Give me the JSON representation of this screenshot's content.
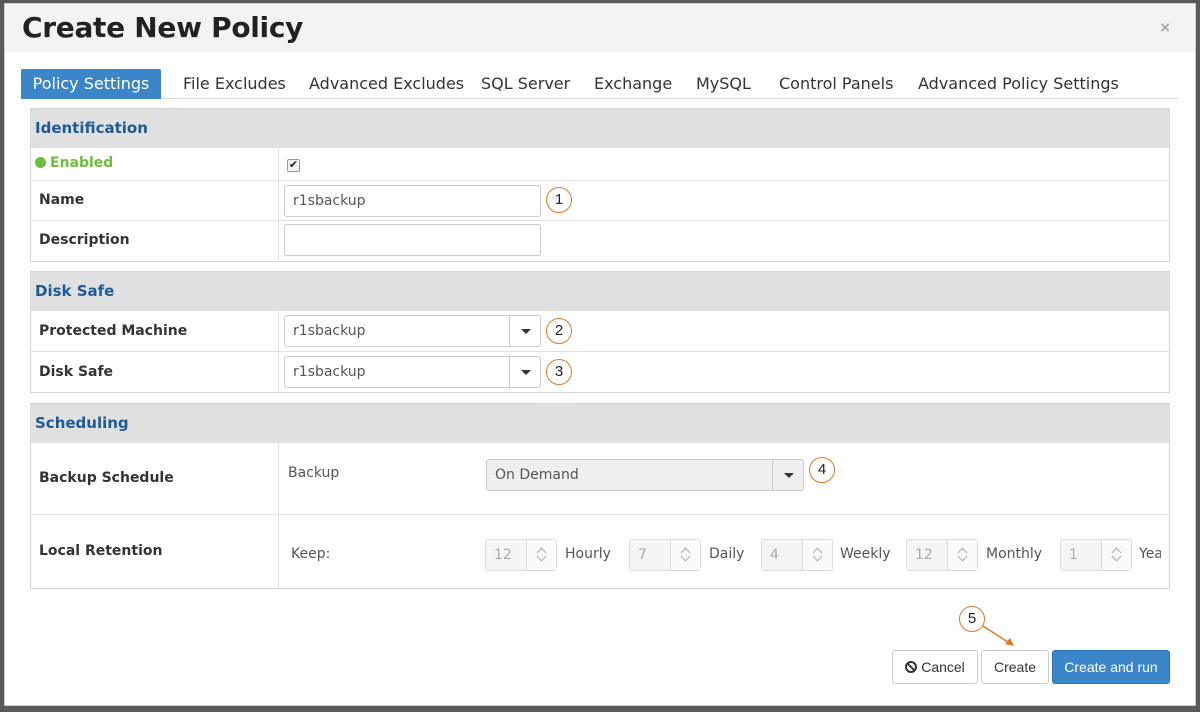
{
  "modal": {
    "title": "Create New Policy",
    "close": "×"
  },
  "tabs": [
    "Policy Settings",
    "File Excludes",
    "Advanced Excludes",
    "SQL Server",
    "Exchange",
    "MySQL",
    "Control Panels",
    "Advanced Policy Settings"
  ],
  "identification": {
    "heading": "Identification",
    "enabled_label": "Enabled",
    "enabled_checked": "✔",
    "name_label": "Name",
    "name_value": "r1sbackup",
    "description_label": "Description",
    "description_value": ""
  },
  "disk_safe": {
    "heading": "Disk Safe",
    "machine_label": "Protected Machine",
    "machine_value": "r1sbackup",
    "safe_label": "Disk Safe",
    "safe_value": "r1sbackup"
  },
  "scheduling": {
    "heading": "Scheduling",
    "schedule_label": "Backup Schedule",
    "backup_text": "Backup",
    "schedule_value": "On Demand",
    "retention_label": "Local Retention",
    "keep_text": "Keep:",
    "retention": [
      {
        "value": "12",
        "unit": "Hourly"
      },
      {
        "value": "7",
        "unit": "Daily"
      },
      {
        "value": "4",
        "unit": "Weekly"
      },
      {
        "value": "12",
        "unit": "Monthly"
      },
      {
        "value": "1",
        "unit": "Yea"
      }
    ]
  },
  "callouts": [
    "1",
    "2",
    "3",
    "4",
    "5"
  ],
  "footer": {
    "cancel": "Cancel",
    "create": "Create",
    "create_run": "Create and run"
  },
  "colors": {
    "primary": "#3a86c9",
    "heading": "#1f5a96",
    "enabled": "#6cbf3a",
    "callout": "#e07a2a"
  }
}
